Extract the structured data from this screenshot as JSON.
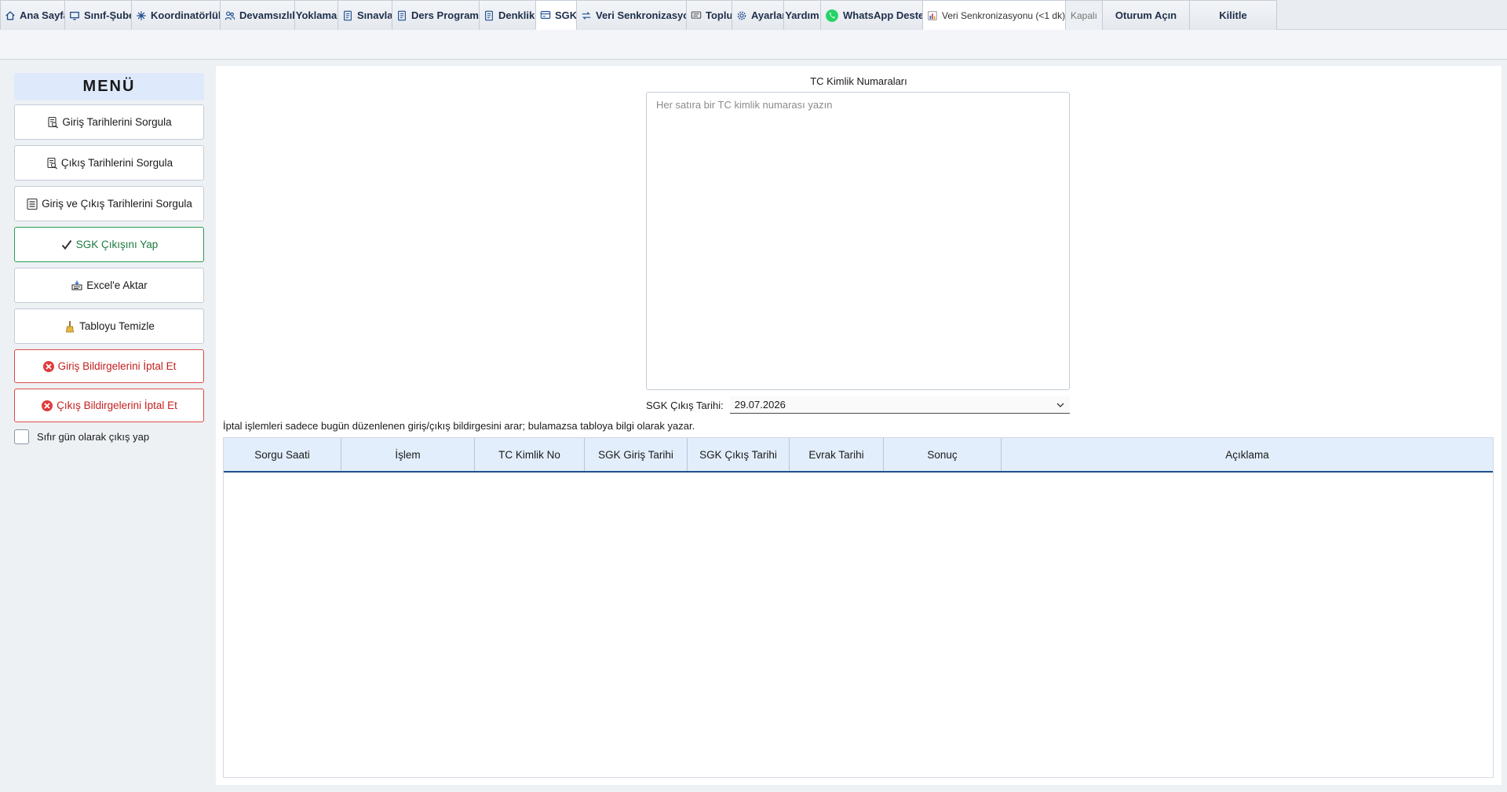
{
  "tabs": [
    {
      "label": "Ana Sayfa",
      "icon": "home-icon"
    },
    {
      "label": "Sınıf-Şube",
      "icon": "monitor-icon"
    },
    {
      "label": "Koordinatörlük",
      "icon": "sparkle-icon"
    },
    {
      "label": "Devamsızlık",
      "icon": "people-icon"
    },
    {
      "label": "Yoklama",
      "icon": ""
    },
    {
      "label": "Sınavlar",
      "icon": "document-icon"
    },
    {
      "label": "Ders Programı",
      "icon": "document-icon"
    },
    {
      "label": "Denklik",
      "icon": "document-icon"
    },
    {
      "label": "SGK",
      "icon": "card-icon",
      "active": true
    },
    {
      "label": "Veri Senkronizasyon",
      "icon": "sync-icon"
    },
    {
      "label": "Toplu",
      "icon": "message-icon"
    },
    {
      "label": "Ayarlar",
      "icon": "gear-icon"
    },
    {
      "label": "Yardım",
      "icon": ""
    },
    {
      "label": "WhatsApp Destek",
      "icon": "whatsapp-icon"
    }
  ],
  "status_tab": {
    "label": "Veri Senkronizasyonu (<1 dk)",
    "icon": "chart-icon"
  },
  "closed_tab": {
    "label": "Kapalı"
  },
  "login_button": {
    "label": "Oturum Açın"
  },
  "lock_button": {
    "label": "Kilitle"
  },
  "sidebar": {
    "title": "MENÜ",
    "buttons": [
      {
        "label": "Giriş Tarihlerini Sorgula",
        "icon": "document-search-icon",
        "style": "normal"
      },
      {
        "label": "Çıkış Tarihlerini Sorgula",
        "icon": "document-search-icon",
        "style": "normal"
      },
      {
        "label": "Giriş ve Çıkış Tarihlerini Sorgula",
        "icon": "list-icon",
        "style": "normal"
      },
      {
        "label": "SGK Çıkışını Yap",
        "icon": "checkmark-icon",
        "style": "green"
      },
      {
        "label": "Excel'e Aktar",
        "icon": "export-icon",
        "style": "normal"
      },
      {
        "label": "Tabloyu Temizle",
        "icon": "broom-icon",
        "style": "normal"
      },
      {
        "label": "Giriş Bildirgelerini İptal Et",
        "icon": "cancel-icon",
        "style": "red"
      },
      {
        "label": "Çıkış Bildirgelerini İptal Et",
        "icon": "cancel-icon",
        "style": "red"
      }
    ],
    "checkbox": {
      "label": "Sıfır gün olarak çıkış yap",
      "checked": false
    }
  },
  "main": {
    "tc_label": "TC Kimlik Numaraları",
    "tc_placeholder": "Her satıra bir TC kimlik numarası yazın",
    "tc_value": "",
    "date_label": "SGK Çıkış Tarihi:",
    "date_value": "29.07.2026",
    "info_text": "İptal işlemleri sadece bugün düzenlenen giriş/çıkış bildirgesini arar; bulamazsa tabloya bilgi olarak yazar.",
    "table": {
      "columns": [
        "Sorgu Saati",
        "İşlem",
        "TC Kimlik No",
        "SGK Giriş Tarihi",
        "SGK Çıkış Tarihi",
        "Evrak Tarihi",
        "Sonuç",
        "Açıklama"
      ],
      "rows": []
    }
  },
  "colors": {
    "accent": "#1d4f8c",
    "green": "#1e7a3f",
    "red": "#c42121",
    "header_bg": "#e2eefc"
  }
}
